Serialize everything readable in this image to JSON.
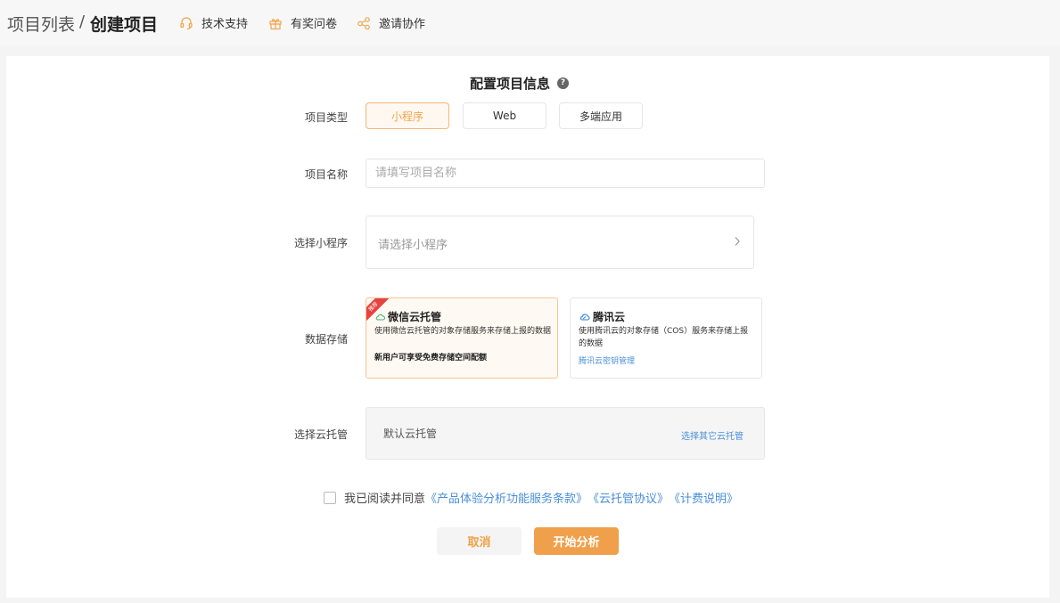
{
  "header": {
    "breadcrumb_parent": "项目列表",
    "breadcrumb_sep": "/",
    "breadcrumb_current": "创建项目",
    "links": [
      {
        "label": "技术支持",
        "icon": "headset-icon"
      },
      {
        "label": "有奖问卷",
        "icon": "gift-icon"
      },
      {
        "label": "邀请协作",
        "icon": "share-icon"
      }
    ]
  },
  "form": {
    "title": "配置项目信息",
    "help": "?",
    "type_label": "项目类型",
    "types": [
      "小程序",
      "Web",
      "多端应用"
    ],
    "selected_type": "小程序",
    "name_label": "项目名称",
    "name_placeholder": "请填写项目名称",
    "mini_label": "选择小程序",
    "mini_placeholder": "请选择小程序",
    "storage_label": "数据存储",
    "storage": {
      "wechat": {
        "badge": "推荐",
        "title": "微信云托管",
        "desc": "使用微信云托管的对象存储服务来存储上报的数据",
        "note": "新用户可享受免费存储空间配额"
      },
      "tencent": {
        "title": "腾讯云",
        "desc": "使用腾讯云的对象存储（COS）服务来存储上报的数据",
        "link": "腾讯云密钥管理"
      }
    },
    "host_label": "选择云托管",
    "host_default": "默认云托管",
    "host_other": "选择其它云托管",
    "agree_prefix": "我已阅读并同意",
    "agree_links": [
      "《产品体验分析功能服务条款》",
      "《云托管协议》",
      "《计费说明》"
    ],
    "cancel": "取消",
    "start": "开始分析"
  },
  "colors": {
    "accent": "#f0a04b",
    "link": "#4a8fd8",
    "badge": "#e64340"
  }
}
